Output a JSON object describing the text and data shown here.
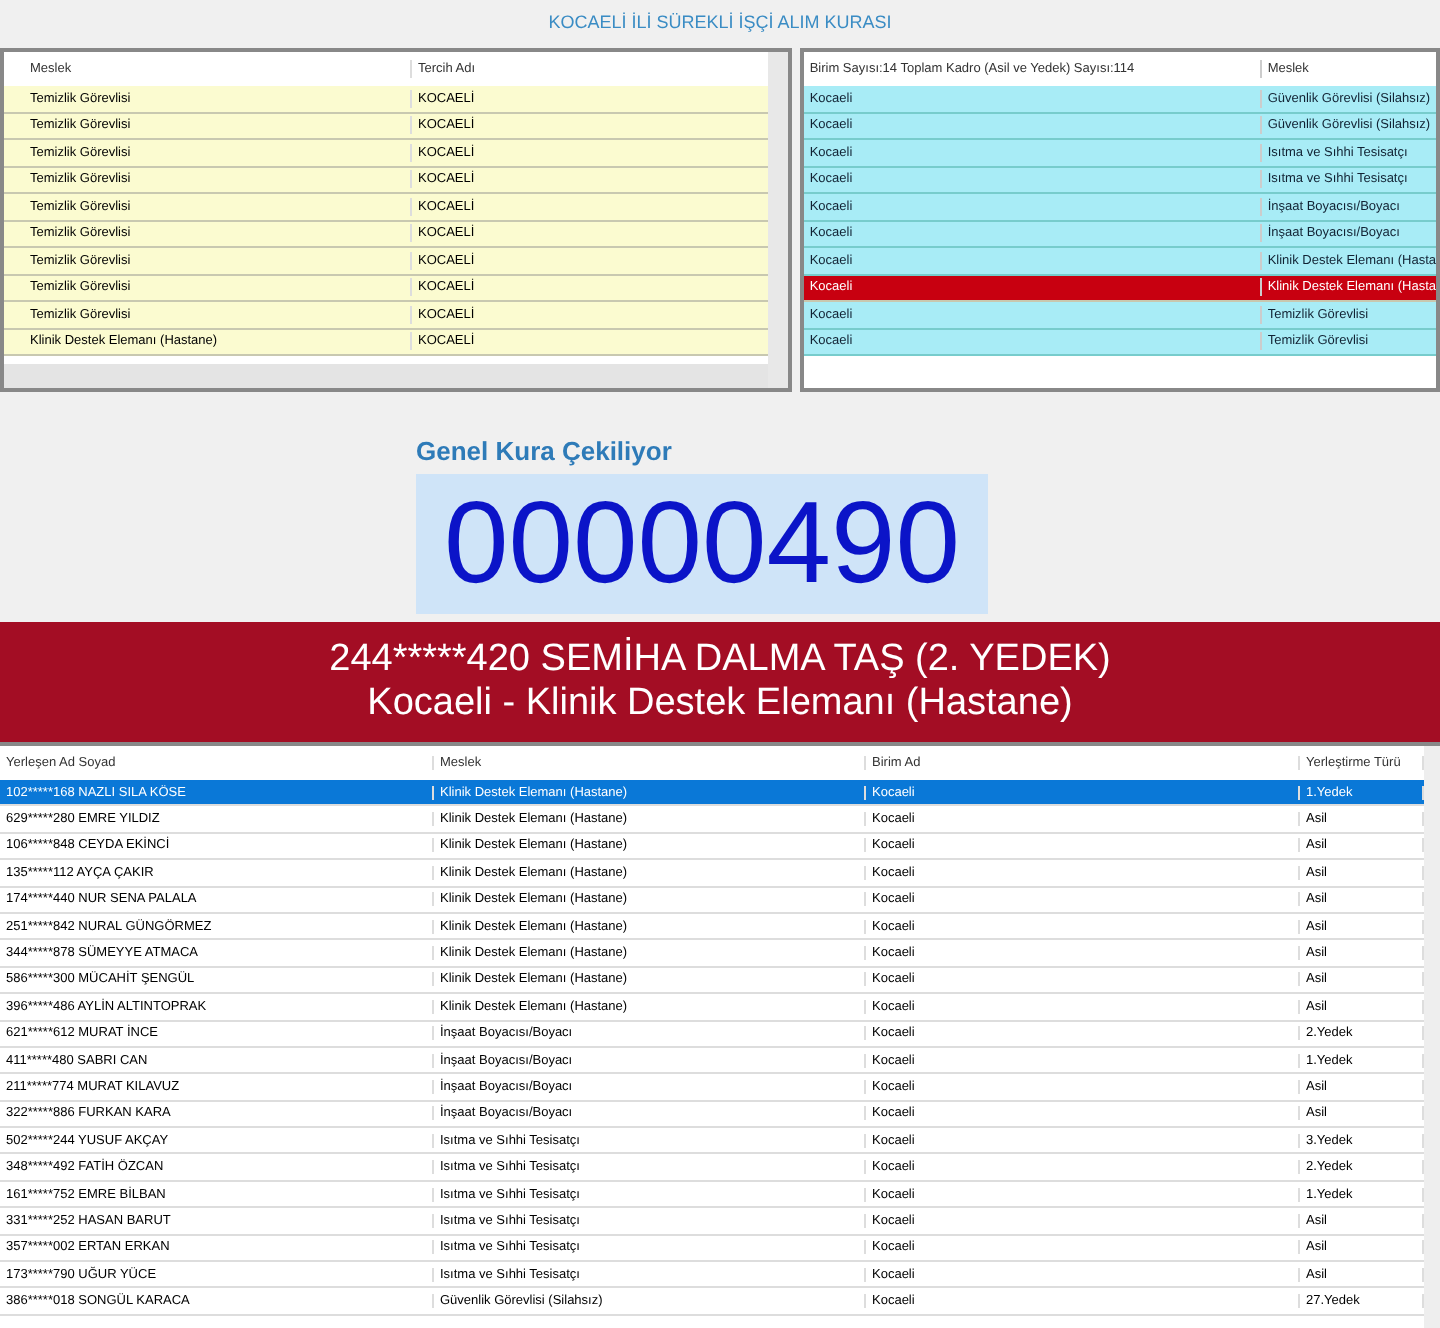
{
  "title": "KOCAELİ İLİ SÜREKLİ İŞÇİ ALIM KURASI",
  "left_grid": {
    "columns": [
      "Meslek",
      "Tercih Adı"
    ],
    "rows": [
      {
        "meslek": "Temizlik Görevlisi",
        "tercih": "KOCAELİ"
      },
      {
        "meslek": "Temizlik Görevlisi",
        "tercih": "KOCAELİ"
      },
      {
        "meslek": "Temizlik Görevlisi",
        "tercih": "KOCAELİ"
      },
      {
        "meslek": "Temizlik Görevlisi",
        "tercih": "KOCAELİ"
      },
      {
        "meslek": "Temizlik Görevlisi",
        "tercih": "KOCAELİ"
      },
      {
        "meslek": "Temizlik Görevlisi",
        "tercih": "KOCAELİ"
      },
      {
        "meslek": "Temizlik Görevlisi",
        "tercih": "KOCAELİ"
      },
      {
        "meslek": "Temizlik Görevlisi",
        "tercih": "KOCAELİ"
      },
      {
        "meslek": "Temizlik Görevlisi",
        "tercih": "KOCAELİ"
      },
      {
        "meslek": "Klinik Destek Elemanı (Hastane)",
        "tercih": "KOCAELİ"
      }
    ]
  },
  "right_grid": {
    "columns": [
      "Birim Sayısı:14 Toplam Kadro (Asil ve Yedek) Sayısı:114",
      "Meslek"
    ],
    "rows": [
      {
        "birim": "Kocaeli",
        "meslek": "Güvenlik Görevlisi (Silahsız)",
        "selected": false
      },
      {
        "birim": "Kocaeli",
        "meslek": "Güvenlik Görevlisi (Silahsız)",
        "selected": false
      },
      {
        "birim": "Kocaeli",
        "meslek": "Isıtma ve Sıhhi Tesisatçı",
        "selected": false
      },
      {
        "birim": "Kocaeli",
        "meslek": "Isıtma ve Sıhhi Tesisatçı",
        "selected": false
      },
      {
        "birim": "Kocaeli",
        "meslek": "İnşaat Boyacısı/Boyacı",
        "selected": false
      },
      {
        "birim": "Kocaeli",
        "meslek": "İnşaat Boyacısı/Boyacı",
        "selected": false
      },
      {
        "birim": "Kocaeli",
        "meslek": "Klinik Destek Elemanı (Hasta",
        "selected": false
      },
      {
        "birim": "Kocaeli",
        "meslek": "Klinik Destek Elemanı (Hasta",
        "selected": true
      },
      {
        "birim": "Kocaeli",
        "meslek": "Temizlik Görevlisi",
        "selected": false
      },
      {
        "birim": "Kocaeli",
        "meslek": "Temizlik Görevlisi",
        "selected": false
      }
    ]
  },
  "draw": {
    "label": "Genel Kura Çekiliyor",
    "counter": "00000490"
  },
  "banner": {
    "line_1": "244*****420 SEMİHA DALMA TAŞ (2. YEDEK)",
    "line_2": "Kocaeli - Klinik Destek Elemanı (Hastane)"
  },
  "results": {
    "columns": [
      "Yerleşen Ad Soyad",
      "Meslek",
      "Birim Ad",
      "Yerleştirme Türü"
    ],
    "rows": [
      {
        "cells": [
          "102*****168 NAZLI SILA KÖSE",
          "Klinik Destek Elemanı (Hastane)",
          "Kocaeli",
          "1.Yedek"
        ],
        "selected": true
      },
      {
        "cells": [
          "629*****280 EMRE YILDIZ",
          "Klinik Destek Elemanı (Hastane)",
          "Kocaeli",
          "Asil"
        ],
        "selected": false
      },
      {
        "cells": [
          "106*****848 CEYDA EKİNCİ",
          "Klinik Destek Elemanı (Hastane)",
          "Kocaeli",
          "Asil"
        ],
        "selected": false
      },
      {
        "cells": [
          "135*****112 AYÇA ÇAKIR",
          "Klinik Destek Elemanı (Hastane)",
          "Kocaeli",
          "Asil"
        ],
        "selected": false
      },
      {
        "cells": [
          "174*****440 NUR SENA PALALA",
          "Klinik Destek Elemanı (Hastane)",
          "Kocaeli",
          "Asil"
        ],
        "selected": false
      },
      {
        "cells": [
          "251*****842 NURAL GÜNGÖRMEZ",
          "Klinik Destek Elemanı (Hastane)",
          "Kocaeli",
          "Asil"
        ],
        "selected": false
      },
      {
        "cells": [
          "344*****878 SÜMEYYE ATMACA",
          "Klinik Destek Elemanı (Hastane)",
          "Kocaeli",
          "Asil"
        ],
        "selected": false
      },
      {
        "cells": [
          "586*****300 MÜCAHİT ŞENGÜL",
          "Klinik Destek Elemanı (Hastane)",
          "Kocaeli",
          "Asil"
        ],
        "selected": false
      },
      {
        "cells": [
          "396*****486 AYLİN ALTINTOPRAK",
          "Klinik Destek Elemanı (Hastane)",
          "Kocaeli",
          "Asil"
        ],
        "selected": false
      },
      {
        "cells": [
          "621*****612 MURAT İNCE",
          "İnşaat Boyacısı/Boyacı",
          "Kocaeli",
          "2.Yedek"
        ],
        "selected": false
      },
      {
        "cells": [
          "411*****480 SABRI CAN",
          "İnşaat Boyacısı/Boyacı",
          "Kocaeli",
          "1.Yedek"
        ],
        "selected": false
      },
      {
        "cells": [
          "211*****774 MURAT KILAVUZ",
          "İnşaat Boyacısı/Boyacı",
          "Kocaeli",
          "Asil"
        ],
        "selected": false
      },
      {
        "cells": [
          "322*****886 FURKAN KARA",
          "İnşaat Boyacısı/Boyacı",
          "Kocaeli",
          "Asil"
        ],
        "selected": false
      },
      {
        "cells": [
          "502*****244 YUSUF AKÇAY",
          "Isıtma ve Sıhhi Tesisatçı",
          "Kocaeli",
          "3.Yedek"
        ],
        "selected": false
      },
      {
        "cells": [
          "348*****492 FATİH ÖZCAN",
          "Isıtma ve Sıhhi Tesisatçı",
          "Kocaeli",
          "2.Yedek"
        ],
        "selected": false
      },
      {
        "cells": [
          "161*****752 EMRE BİLBAN",
          "Isıtma ve Sıhhi Tesisatçı",
          "Kocaeli",
          "1.Yedek"
        ],
        "selected": false
      },
      {
        "cells": [
          "331*****252 HASAN BARUT",
          "Isıtma ve Sıhhi Tesisatçı",
          "Kocaeli",
          "Asil"
        ],
        "selected": false
      },
      {
        "cells": [
          "357*****002 ERTAN ERKAN",
          "Isıtma ve Sıhhi Tesisatçı",
          "Kocaeli",
          "Asil"
        ],
        "selected": false
      },
      {
        "cells": [
          "173*****790 UĞUR YÜCE",
          "Isıtma ve Sıhhi Tesisatçı",
          "Kocaeli",
          "Asil"
        ],
        "selected": false
      },
      {
        "cells": [
          "386*****018 SONGÜL KARACA",
          "Güvenlik Görevlisi (Silahsız)",
          "Kocaeli",
          "27.Yedek"
        ],
        "selected": false
      }
    ]
  }
}
